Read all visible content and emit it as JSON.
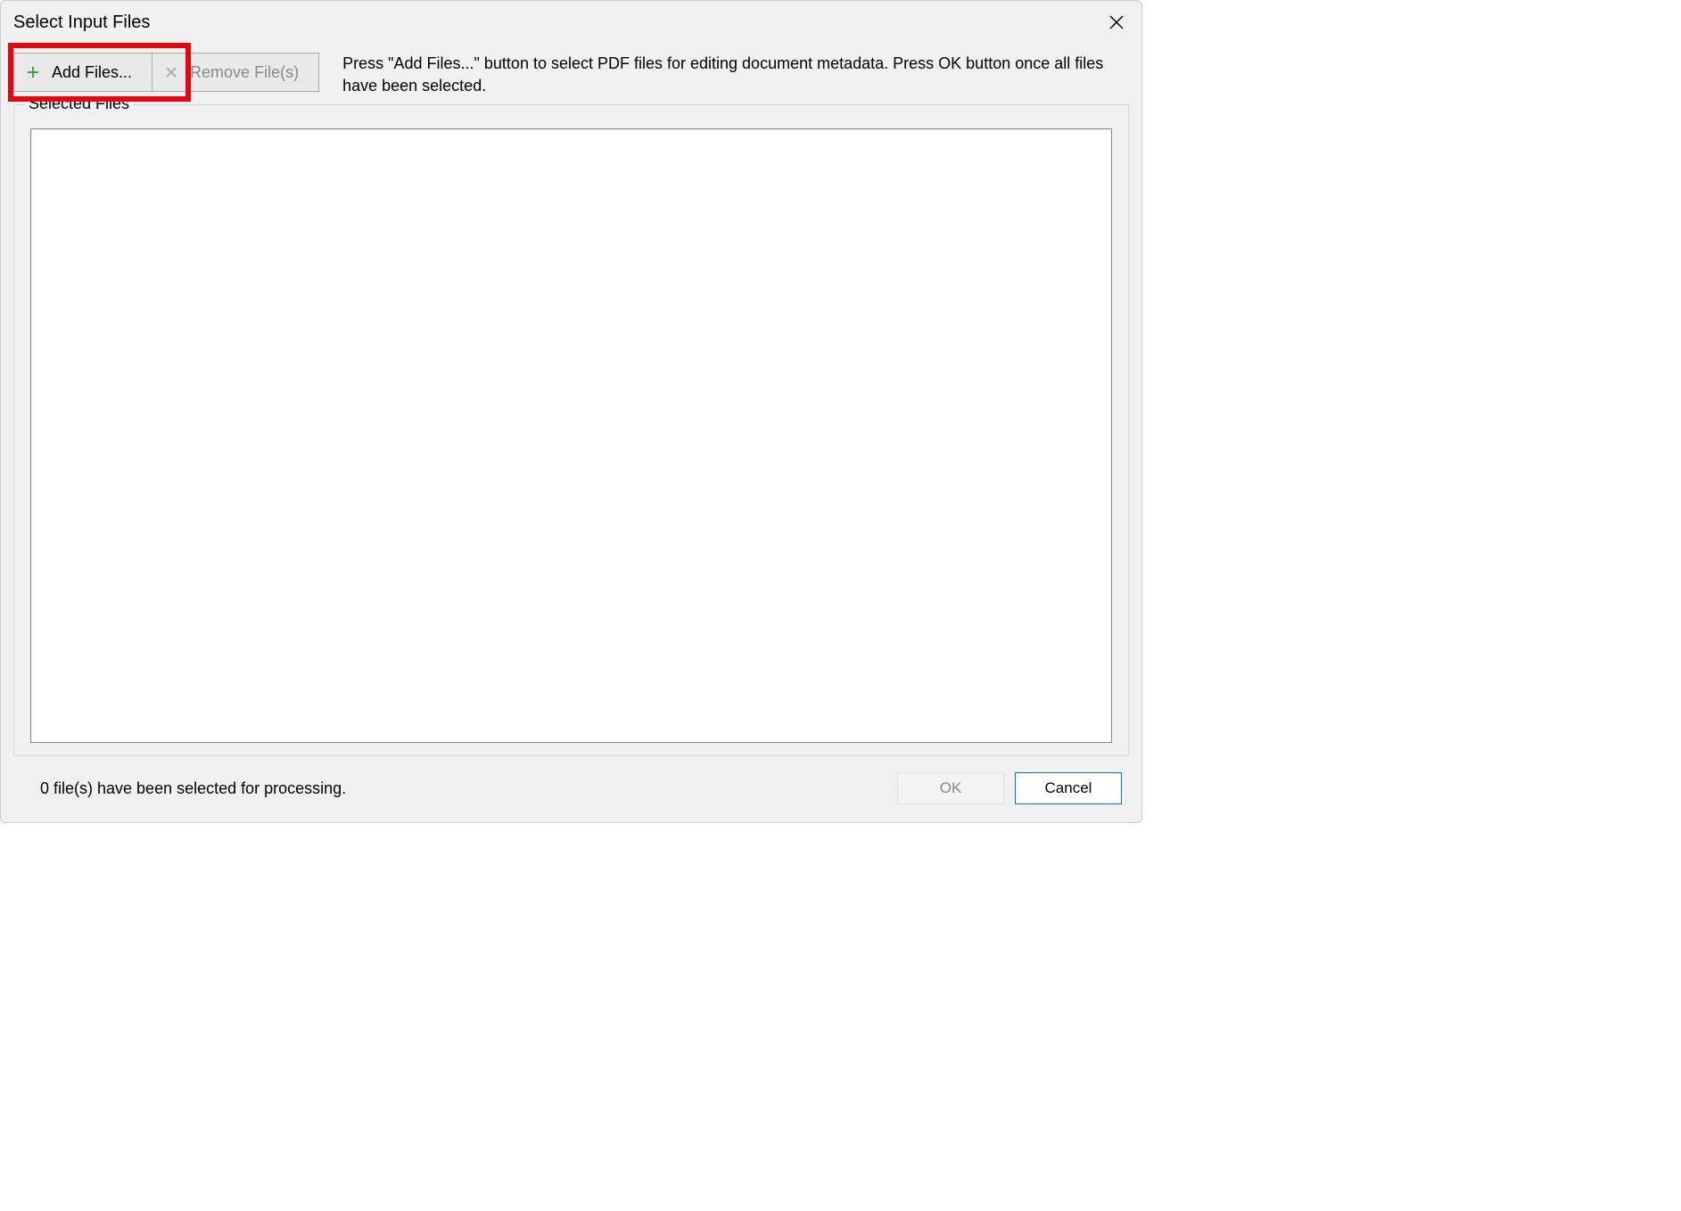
{
  "dialog": {
    "title": "Select Input Files",
    "instruction": "Press \"Add Files...\" button to select PDF files for editing document metadata. Press OK button once all files have been selected.",
    "buttons": {
      "add_files": "Add Files...",
      "remove_files": "Remove File(s)",
      "ok": "OK",
      "cancel": "Cancel"
    },
    "group_label": "Selected Files",
    "status": "0 file(s) have been selected for processing."
  }
}
